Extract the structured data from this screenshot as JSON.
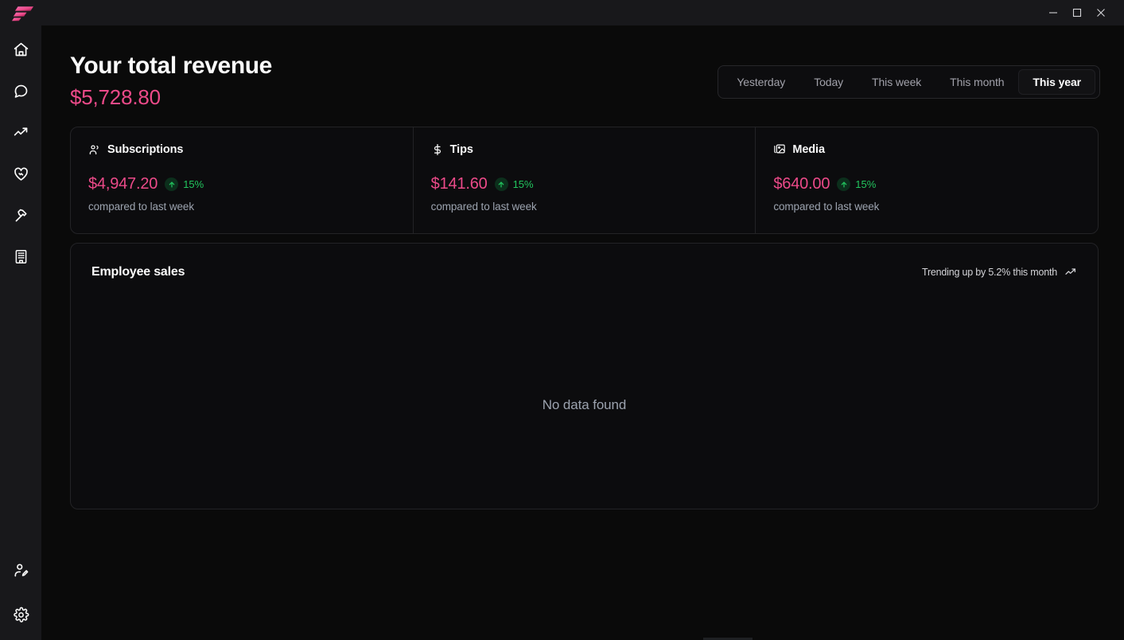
{
  "window": {
    "logo_name": "app-logo",
    "controls": [
      {
        "name": "minimize",
        "label": "Minimize"
      },
      {
        "name": "maximize",
        "label": "Maximize"
      },
      {
        "name": "close",
        "label": "Close"
      }
    ]
  },
  "sidebar": {
    "top_items": [
      {
        "icon": "home-icon",
        "label": "Home"
      },
      {
        "icon": "message-icon",
        "label": "Messages"
      },
      {
        "icon": "trending-up-icon",
        "label": "Analytics"
      },
      {
        "icon": "heart-handshake-icon",
        "label": "Community"
      },
      {
        "icon": "hammer-icon",
        "label": "Tools"
      },
      {
        "icon": "building-icon",
        "label": "Business"
      }
    ],
    "bottom_items": [
      {
        "icon": "user-edit-icon",
        "label": "Profile"
      },
      {
        "icon": "gear-icon",
        "label": "Settings"
      }
    ]
  },
  "header": {
    "title": "Your total revenue",
    "amount": "$5,728.80"
  },
  "range_tabs": {
    "options": [
      "Yesterday",
      "Today",
      "This week",
      "This month",
      "This year"
    ],
    "selected": "This year",
    "items": [
      {
        "label": "Yesterday",
        "active": false
      },
      {
        "label": "Today",
        "active": false
      },
      {
        "label": "This week",
        "active": false
      },
      {
        "label": "This month",
        "active": false
      },
      {
        "label": "This year",
        "active": true
      }
    ]
  },
  "stats": [
    {
      "icon": "users-icon",
      "title": "Subscriptions",
      "value": "$4,947.20",
      "trend_direction": "up",
      "trend_pct": "15%",
      "subtitle": "compared to last week"
    },
    {
      "icon": "dollar-icon",
      "title": "Tips",
      "value": "$141.60",
      "trend_direction": "up",
      "trend_pct": "15%",
      "subtitle": "compared to last week"
    },
    {
      "icon": "images-icon",
      "title": "Media",
      "value": "$640.00",
      "trend_direction": "up",
      "trend_pct": "15%",
      "subtitle": "compared to last week"
    }
  ],
  "employee_sales": {
    "title": "Employee sales",
    "trend_text": "Trending up by 5.2% this month",
    "trend_icon": "trending-up-icon",
    "empty_state": "No data found"
  },
  "colors": {
    "accent_pink": "#ec4a89",
    "positive_green": "#22c55e",
    "muted_text": "#9ca3af",
    "panel_bg": "#0c0c0e",
    "chrome_bg": "#18181b",
    "app_bg": "#0a0a0a",
    "border": "#232326"
  }
}
